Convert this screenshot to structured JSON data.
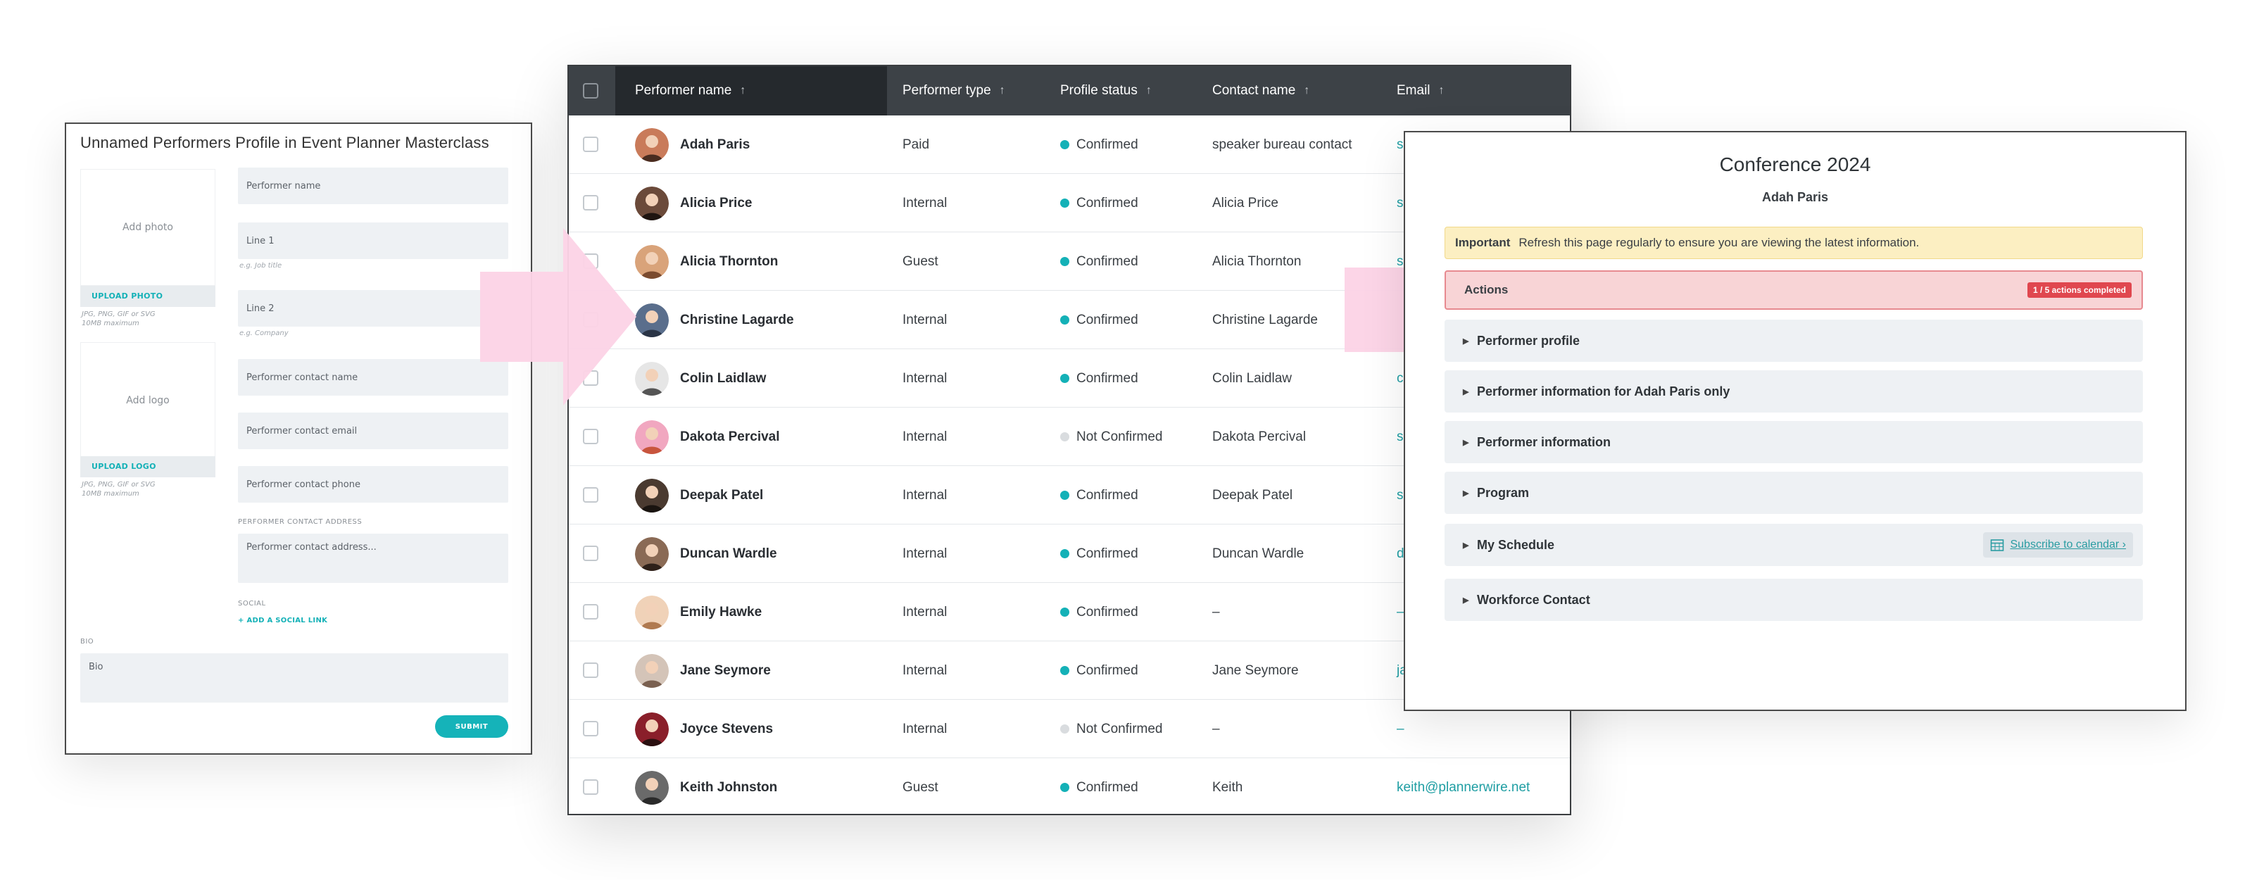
{
  "form": {
    "title": "Unnamed Performers Profile in Event Planner Masterclass",
    "add_photo": "Add photo",
    "upload_photo": "UPLOAD PHOTO",
    "photo_hint_1": "JPG, PNG, GIF or SVG",
    "photo_hint_2": "10MB maximum",
    "add_logo": "Add logo",
    "upload_logo": "UPLOAD LOGO",
    "logo_hint_1": "JPG, PNG, GIF or SVG",
    "logo_hint_2": "10MB maximum",
    "performer_name_placeholder": "Performer name",
    "line1_placeholder": "Line 1",
    "line1_hint": "e.g. Job title",
    "line2_placeholder": "Line 2",
    "line2_hint": "e.g. Company",
    "contact_name_placeholder": "Performer contact name",
    "contact_email_placeholder": "Performer contact email",
    "contact_phone_placeholder": "Performer contact phone",
    "address_label": "PERFORMER CONTACT ADDRESS",
    "address_placeholder": "Performer contact address...",
    "social_label": "SOCIAL",
    "add_social_link": "+ ADD A SOCIAL LINK",
    "bio_label": "BIO",
    "bio_placeholder": "Bio",
    "submit": "SUBMIT"
  },
  "table": {
    "headers": {
      "name": "Performer name",
      "type": "Performer type",
      "status": "Profile status",
      "contact": "Contact name",
      "email": "Email"
    },
    "rows": [
      {
        "name": "Adah Paris",
        "type": "Paid",
        "status": "Confirmed",
        "contact": "speaker bureau contact",
        "email": "s"
      },
      {
        "name": "Alicia Price",
        "type": "Internal",
        "status": "Confirmed",
        "contact": "Alicia Price",
        "email": "s"
      },
      {
        "name": "Alicia Thornton",
        "type": "Guest",
        "status": "Confirmed",
        "contact": "Alicia Thornton",
        "email": "s"
      },
      {
        "name": "Christine Lagarde",
        "type": "Internal",
        "status": "Confirmed",
        "contact": "Christine Lagarde",
        "email": ""
      },
      {
        "name": "Colin Laidlaw",
        "type": "Internal",
        "status": "Confirmed",
        "contact": "Colin Laidlaw",
        "email": "c"
      },
      {
        "name": "Dakota Percival",
        "type": "Internal",
        "status": "Not Confirmed",
        "contact": "Dakota Percival",
        "email": "s"
      },
      {
        "name": "Deepak Patel",
        "type": "Internal",
        "status": "Confirmed",
        "contact": "Deepak Patel",
        "email": "s"
      },
      {
        "name": "Duncan Wardle",
        "type": "Internal",
        "status": "Confirmed",
        "contact": "Duncan Wardle",
        "email": "d"
      },
      {
        "name": "Emily Hawke",
        "type": "Internal",
        "status": "Confirmed",
        "contact": "–",
        "email": "–"
      },
      {
        "name": "Jane Seymore",
        "type": "Internal",
        "status": "Confirmed",
        "contact": "Jane Seymore",
        "email": "ja"
      },
      {
        "name": "Joyce Stevens",
        "type": "Internal",
        "status": "Not Confirmed",
        "contact": "–",
        "email": "–"
      },
      {
        "name": "Keith Johnston",
        "type": "Guest",
        "status": "Confirmed",
        "contact": "Keith",
        "email": "keith@plannerwire.net"
      }
    ]
  },
  "portal": {
    "title": "Conference 2024",
    "subtitle": "Adah Paris",
    "important_label": "Important",
    "important_text": "Refresh this page regularly to ensure you are viewing the latest information.",
    "actions_label": "Actions",
    "actions_badge": "1 / 5 actions completed",
    "sections": [
      {
        "label": "Performer profile"
      },
      {
        "label": "Performer information for Adah Paris only"
      },
      {
        "label": "Performer information"
      },
      {
        "label": "Program"
      },
      {
        "label": "My Schedule"
      },
      {
        "label": "Workforce Contact"
      }
    ],
    "subscribe": "Subscribe to calendar ›"
  },
  "colors": {
    "confirmed_dot": "#14b1b7",
    "not_confirmed_dot": "#d9dcdf",
    "arrow_pink": "#fcd3e6",
    "accent_teal": "#15b3b9"
  }
}
